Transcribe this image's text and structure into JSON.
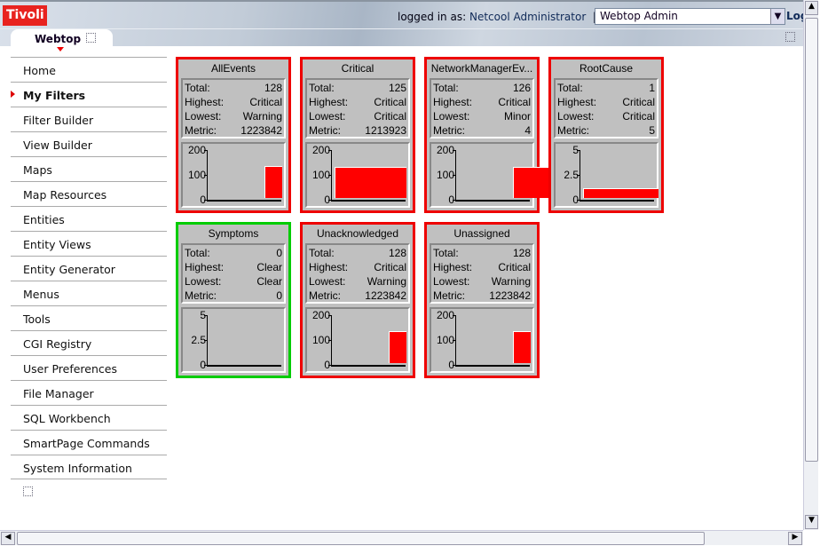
{
  "header": {
    "logo": "Tivoli",
    "logged_in_prefix": "logged in as:",
    "user": "Netcool Administrator",
    "separator": "|",
    "role_select": "Webtop Admin",
    "logout": "Log"
  },
  "tabs": [
    {
      "label": "Webtop",
      "active": true
    }
  ],
  "sidebar": {
    "items": [
      {
        "label": "Home"
      },
      {
        "label": "My Filters",
        "active": true
      },
      {
        "label": "Filter Builder"
      },
      {
        "label": "View Builder"
      },
      {
        "label": "Maps"
      },
      {
        "label": "Map Resources"
      },
      {
        "label": "Entities"
      },
      {
        "label": "Entity Views"
      },
      {
        "label": "Entity Generator"
      },
      {
        "label": "Menus"
      },
      {
        "label": "Tools"
      },
      {
        "label": "CGI Registry"
      },
      {
        "label": "User Preferences"
      },
      {
        "label": "File Manager"
      },
      {
        "label": "SQL Workbench"
      },
      {
        "label": "SmartPage Commands"
      },
      {
        "label": "System Information"
      }
    ]
  },
  "labels": {
    "total": "Total:",
    "highest": "Highest:",
    "lowest": "Lowest:",
    "metric": "Metric:"
  },
  "colors": {
    "critical": "#ff0000",
    "clear": "#00cc00",
    "panel": "#c0c0c0"
  },
  "monitors": [
    {
      "name": "AllEvents",
      "total": "128",
      "highest": "Critical",
      "lowest": "Warning",
      "metric": "1223842",
      "status": "critical",
      "ymax": 200,
      "ticks": [
        "200",
        "100",
        "0"
      ],
      "bar_value": 128
    },
    {
      "name": "Critical",
      "total": "125",
      "highest": "Critical",
      "lowest": "Critical",
      "metric": "1213923",
      "status": "critical",
      "ymax": 200,
      "ticks": [
        "200",
        "100",
        "0"
      ],
      "bar_value": 125
    },
    {
      "name": "NetworkManagerEv...",
      "total": "126",
      "highest": "Critical",
      "lowest": "Minor",
      "metric": "4",
      "status": "critical",
      "ymax": 200,
      "ticks": [
        "200",
        "100",
        "0"
      ],
      "bar_value": 126
    },
    {
      "name": "RootCause",
      "total": "1",
      "highest": "Critical",
      "lowest": "Critical",
      "metric": "5",
      "status": "critical",
      "ymax": 5,
      "ticks": [
        "5",
        "2.5",
        "0"
      ],
      "bar_value": 1
    },
    {
      "name": "Symptoms",
      "total": "0",
      "highest": "Clear",
      "lowest": "Clear",
      "metric": "0",
      "status": "clear",
      "ymax": 5,
      "ticks": [
        "5",
        "2.5",
        "0"
      ],
      "bar_value": 0
    },
    {
      "name": "Unacknowledged",
      "total": "128",
      "highest": "Critical",
      "lowest": "Warning",
      "metric": "1223842",
      "status": "critical",
      "ymax": 200,
      "ticks": [
        "200",
        "100",
        "0"
      ],
      "bar_value": 128
    },
    {
      "name": "Unassigned",
      "total": "128",
      "highest": "Critical",
      "lowest": "Warning",
      "metric": "1223842",
      "status": "critical",
      "ymax": 200,
      "ticks": [
        "200",
        "100",
        "0"
      ],
      "bar_value": 128
    }
  ]
}
